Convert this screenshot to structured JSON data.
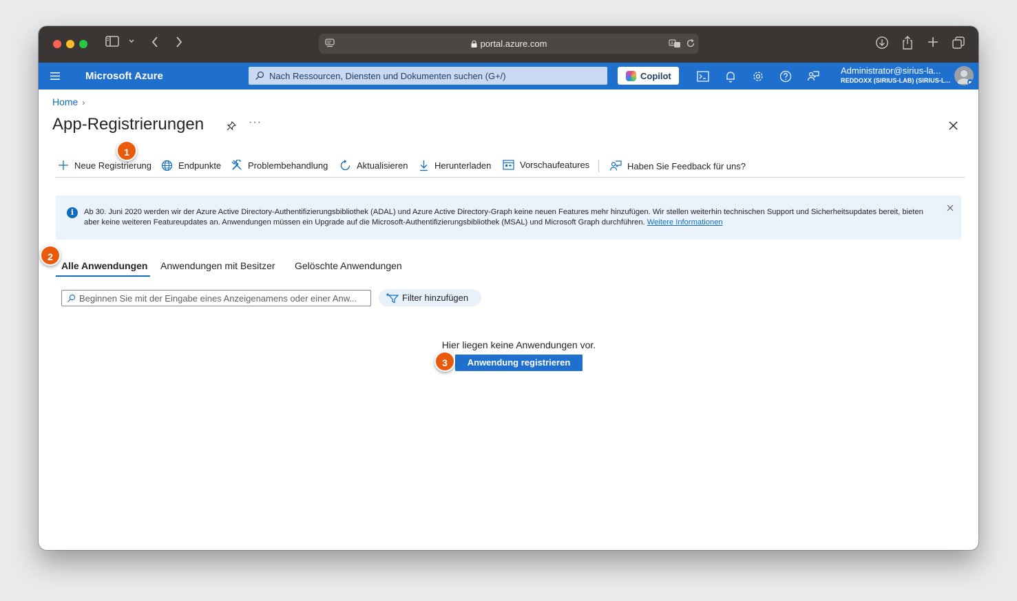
{
  "browser": {
    "url": "portal.azure.com"
  },
  "header": {
    "brand": "Microsoft Azure",
    "search_placeholder": "Nach Ressourcen, Diensten und Dokumenten suchen (G+/)",
    "copilot_label": "Copilot",
    "account_name": "Administrator@sirius-la...",
    "account_tenant": "REDDOXX (SIRIUS-LAB) (SIRIUS-L...",
    "icons": [
      "cloud-shell-icon",
      "bell-icon",
      "gear-icon",
      "help-icon",
      "feedback-icon"
    ]
  },
  "breadcrumb": {
    "home": "Home"
  },
  "page": {
    "title": "App-Registrierungen"
  },
  "toolbar": {
    "new_registration": "Neue Registrierung",
    "endpoints": "Endpunkte",
    "troubleshooting": "Problembehandlung",
    "refresh": "Aktualisieren",
    "download": "Herunterladen",
    "preview_features": "Vorschaufeatures",
    "feedback": "Haben Sie Feedback für uns?"
  },
  "banner": {
    "text": "Ab 30. Juni 2020 werden wir der Azure Active Directory-Authentifizierungsbibliothek (ADAL) und Azure Active Directory-Graph keine neuen Features mehr hinzufügen. Wir stellen weiterhin technischen Support und Sicherheitsupdates bereit, bieten aber keine weiteren Featureupdates an. Anwendungen müssen ein Upgrade auf die Microsoft-Authentifizierungsbibliothek (MSAL) und Microsoft Graph durchführen.",
    "link": "Weitere Informationen"
  },
  "tabs": [
    {
      "label": "Alle Anwendungen",
      "active": true
    },
    {
      "label": "Anwendungen mit Besitzer",
      "active": false
    },
    {
      "label": "Gelöschte Anwendungen",
      "active": false
    }
  ],
  "filter": {
    "placeholder": "Beginnen Sie mit der Eingabe eines Anzeigenamens oder einer Anw...",
    "add_filter": "Filter hinzufügen"
  },
  "empty_state": {
    "message": "Hier liegen keine Anwendungen vor.",
    "button": "Anwendung registrieren"
  },
  "annotations": {
    "step1": "1",
    "step2": "2",
    "step3": "3"
  },
  "colors": {
    "azure_blue": "#1f6fce",
    "link_blue": "#0f6cbd",
    "badge_orange": "#ea5a0c",
    "banner_bg": "#eaf3fb"
  }
}
